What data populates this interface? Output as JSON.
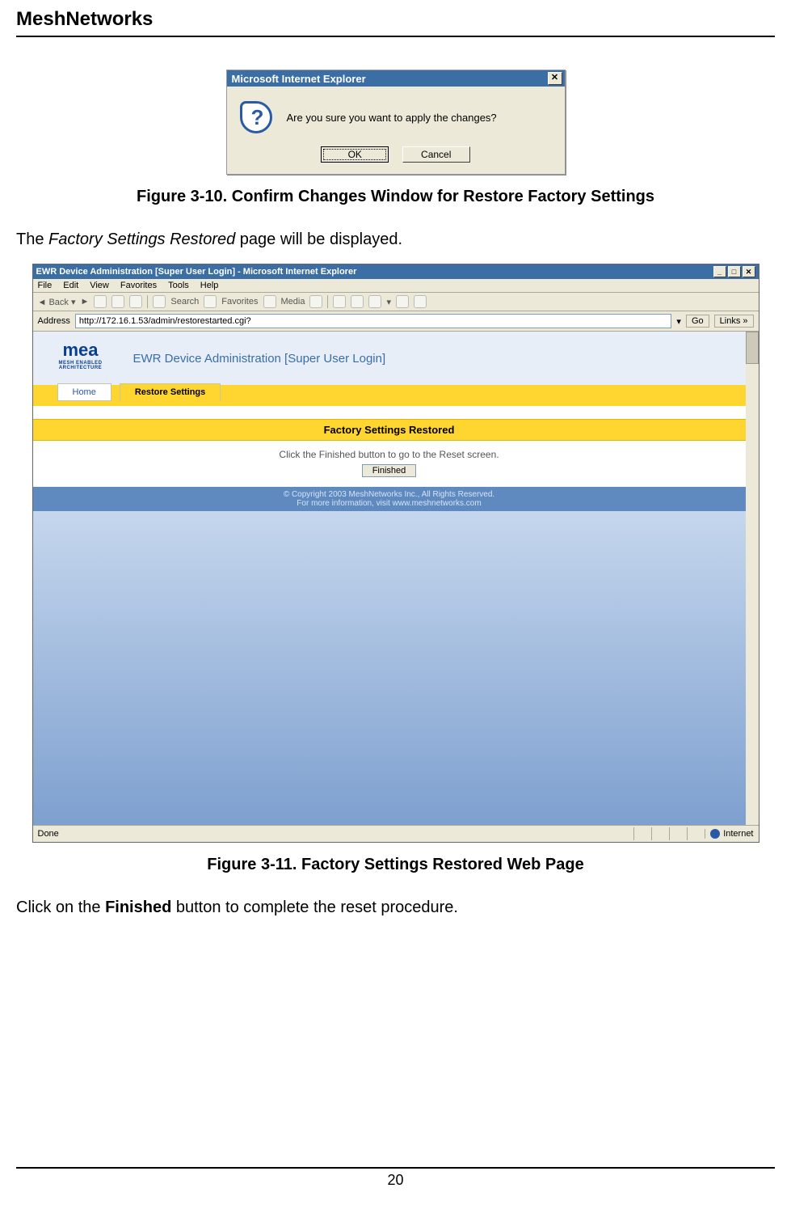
{
  "doc": {
    "header": "MeshNetworks",
    "page_number": "20",
    "caption_1": "Figure 3-10.    Confirm Changes Window for Restore Factory Settings",
    "body_1_pre": "The ",
    "body_1_italic": "Factory Settings Restored",
    "body_1_post": " page will be displayed.",
    "caption_2": "Figure 3-11.   Factory Settings Restored Web Page",
    "body_2_pre": "Click on the ",
    "body_2_bold": "Finished",
    "body_2_post": " button to complete the reset procedure."
  },
  "dialog": {
    "title": "Microsoft Internet Explorer",
    "close_glyph": "✕",
    "message": "Are you sure you want to apply the changes?",
    "ok_label": "OK",
    "cancel_label": "Cancel"
  },
  "browser": {
    "title": "EWR Device Administration [Super User Login] - Microsoft Internet Explorer",
    "win_min": "_",
    "win_max": "□",
    "win_close": "✕",
    "menu": {
      "file": "File",
      "edit": "Edit",
      "view": "View",
      "favorites": "Favorites",
      "tools": "Tools",
      "help": "Help"
    },
    "toolbar": {
      "back": "Back",
      "search": "Search",
      "favorites": "Favorites",
      "media": "Media"
    },
    "address_label": "Address",
    "address_value": "http://172.16.1.53/admin/restorestarted.cgi?",
    "go_label": "Go",
    "links_label": "Links »",
    "page": {
      "logo_text": "mea",
      "logo_sub": "MESH ENABLED ARCHITECTURE",
      "header_title": "EWR Device Administration [Super User Login]",
      "tab_home": "Home",
      "tab_restore": "Restore Settings",
      "banner": "Factory Settings Restored",
      "instruction": "Click the Finished button to go to the Reset screen.",
      "finished_button": "Finished",
      "copyright_line1": "© Copyright 2003 MeshNetworks Inc., All Rights Reserved.",
      "copyright_line2_pre": "For more information, visit ",
      "copyright_link": "www.meshnetworks.com"
    },
    "status": {
      "done": "Done",
      "internet": "Internet"
    }
  }
}
